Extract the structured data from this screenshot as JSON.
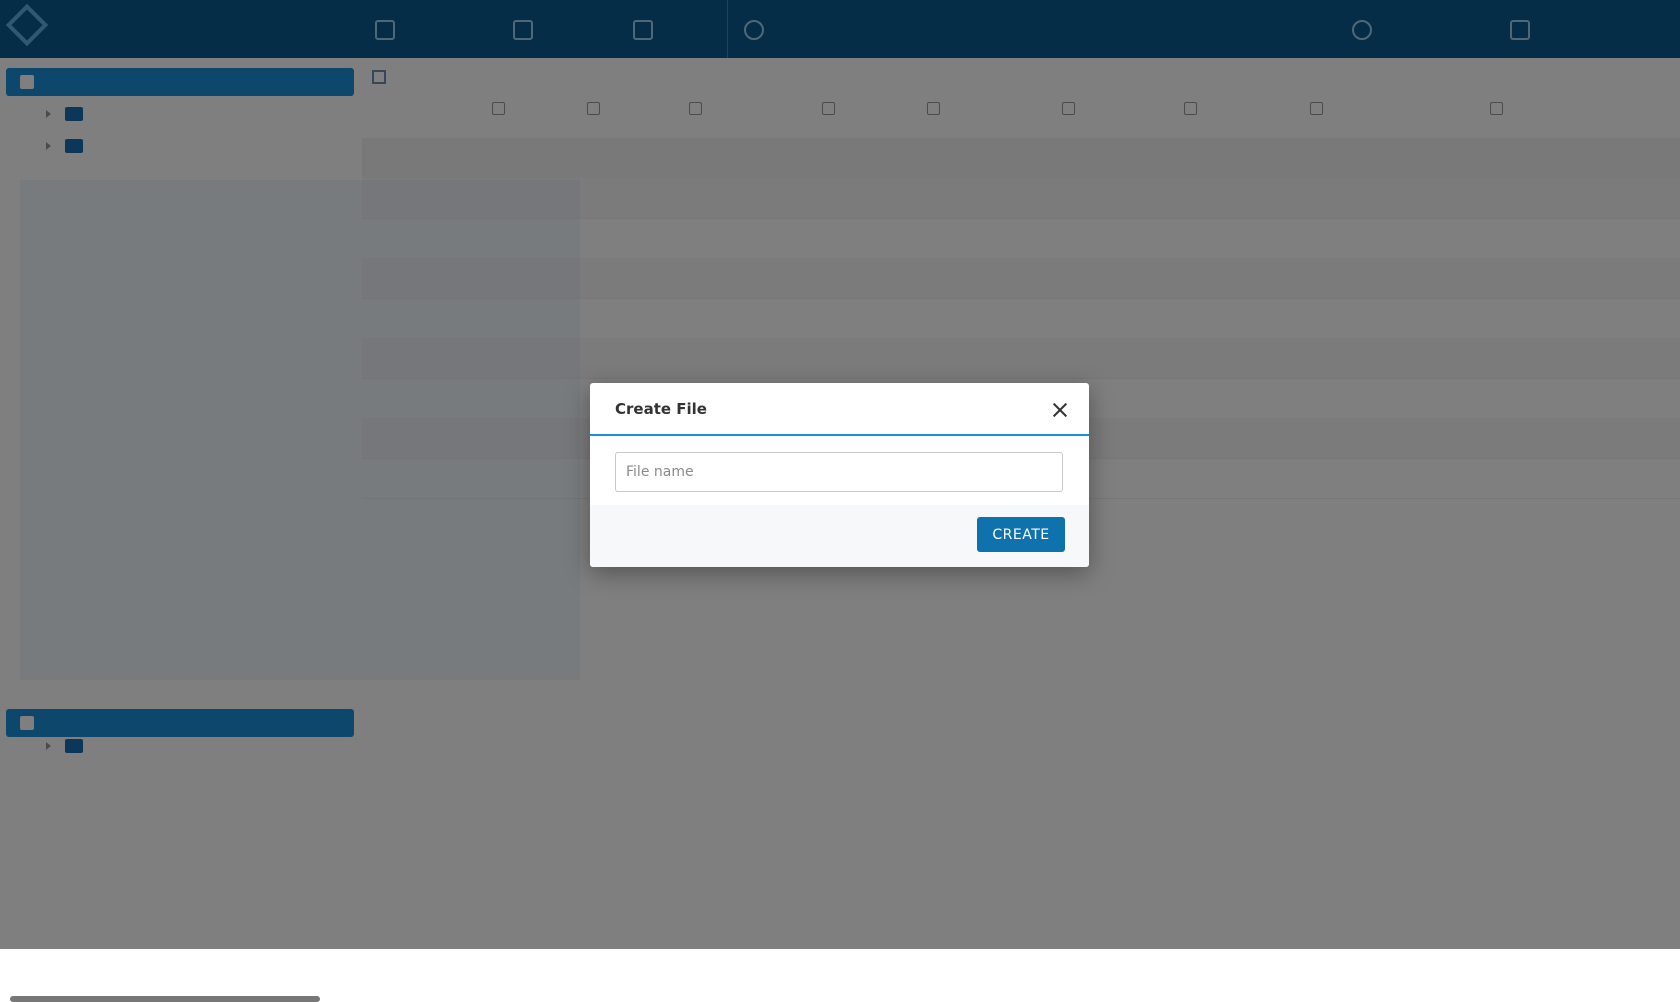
{
  "modal": {
    "title": "Create File",
    "input_placeholder": "File name",
    "create_label": "CREATE"
  }
}
